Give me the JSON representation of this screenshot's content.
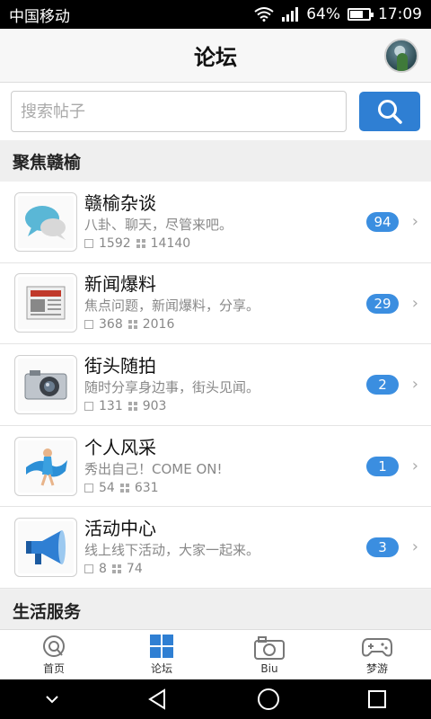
{
  "status": {
    "carrier": "中国移动",
    "battery": "64%",
    "time": "17:09"
  },
  "header": {
    "title": "论坛"
  },
  "search": {
    "placeholder": "搜索帖子"
  },
  "sections": [
    {
      "title": "聚焦赣榆"
    },
    {
      "title": "生活服务"
    }
  ],
  "forums": [
    {
      "name": "赣榆杂谈",
      "desc": "八卦、聊天，尽管来吧。",
      "posts": "1592",
      "replies": "14140",
      "badge": "94"
    },
    {
      "name": "新闻爆料",
      "desc": "焦点问题，新闻爆料，分享。",
      "posts": "368",
      "replies": "2016",
      "badge": "29"
    },
    {
      "name": "街头随拍",
      "desc": "随时分享身边事，街头见闻。",
      "posts": "131",
      "replies": "903",
      "badge": "2"
    },
    {
      "name": "个人风采",
      "desc": "秀出自己！COME ON!",
      "posts": "54",
      "replies": "631",
      "badge": "1"
    },
    {
      "name": "活动中心",
      "desc": "线上线下活动，大家一起来。",
      "posts": "8",
      "replies": "74",
      "badge": "3"
    }
  ],
  "tabs": [
    {
      "label": "首页",
      "icon": "home-icon"
    },
    {
      "label": "论坛",
      "icon": "forum-grid-icon"
    },
    {
      "label": "Biu",
      "icon": "camera-icon"
    },
    {
      "label": "梦游",
      "icon": "gamepad-icon"
    }
  ],
  "colors": {
    "accent": "#2f7fd3",
    "badge": "#3b8ee0"
  }
}
